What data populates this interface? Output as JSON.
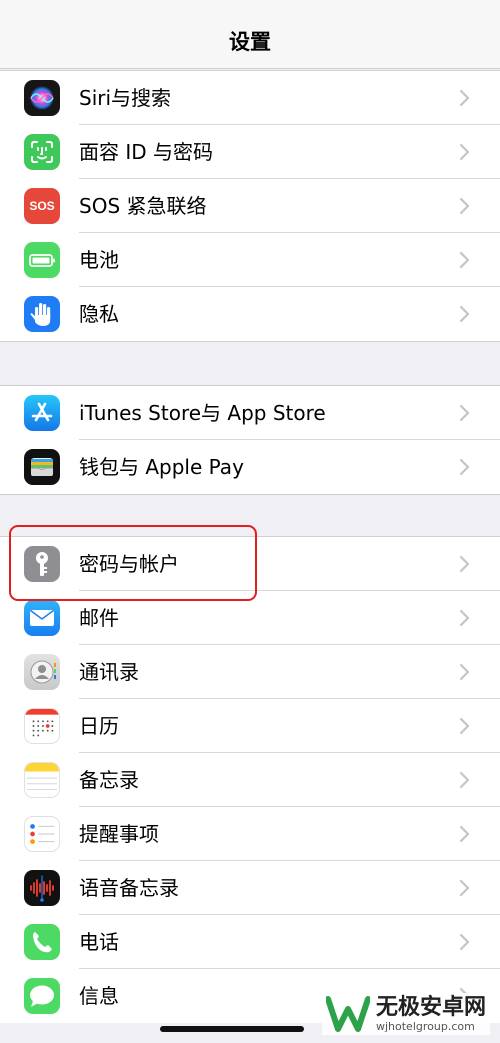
{
  "navbar": {
    "title": "设置"
  },
  "groups": [
    {
      "items": [
        {
          "label": "Siri与搜索",
          "icon": "siri-icon"
        },
        {
          "label": "面容 ID 与密码",
          "icon": "face-id-icon"
        },
        {
          "label": "SOS 紧急联络",
          "icon": "sos-icon",
          "icon_text": "SOS"
        },
        {
          "label": "电池",
          "icon": "battery-icon"
        },
        {
          "label": "隐私",
          "icon": "privacy-hand-icon"
        }
      ]
    },
    {
      "items": [
        {
          "label": "iTunes Store与 App Store",
          "icon": "app-store-icon"
        },
        {
          "label": "钱包与 Apple Pay",
          "icon": "wallet-icon"
        }
      ]
    },
    {
      "items": [
        {
          "label": "密码与帐户",
          "icon": "key-icon"
        },
        {
          "label": "邮件",
          "icon": "mail-icon"
        },
        {
          "label": "通讯录",
          "icon": "contacts-icon"
        },
        {
          "label": "日历",
          "icon": "calendar-icon"
        },
        {
          "label": "备忘录",
          "icon": "notes-icon"
        },
        {
          "label": "提醒事项",
          "icon": "reminders-icon"
        },
        {
          "label": "语音备忘录",
          "icon": "voice-memos-icon"
        },
        {
          "label": "电话",
          "icon": "phone-icon"
        },
        {
          "label": "信息",
          "icon": "messages-icon"
        }
      ]
    }
  ],
  "watermark": {
    "main": "无极安卓网",
    "url": "wjhotelgroup.com"
  },
  "colors": {
    "background": "#efeff4",
    "highlight": "#e02020",
    "chevron": "#c4c4c9",
    "sos": "#e5483b",
    "green": "#4cd964",
    "blue": "#1f7cf5"
  }
}
